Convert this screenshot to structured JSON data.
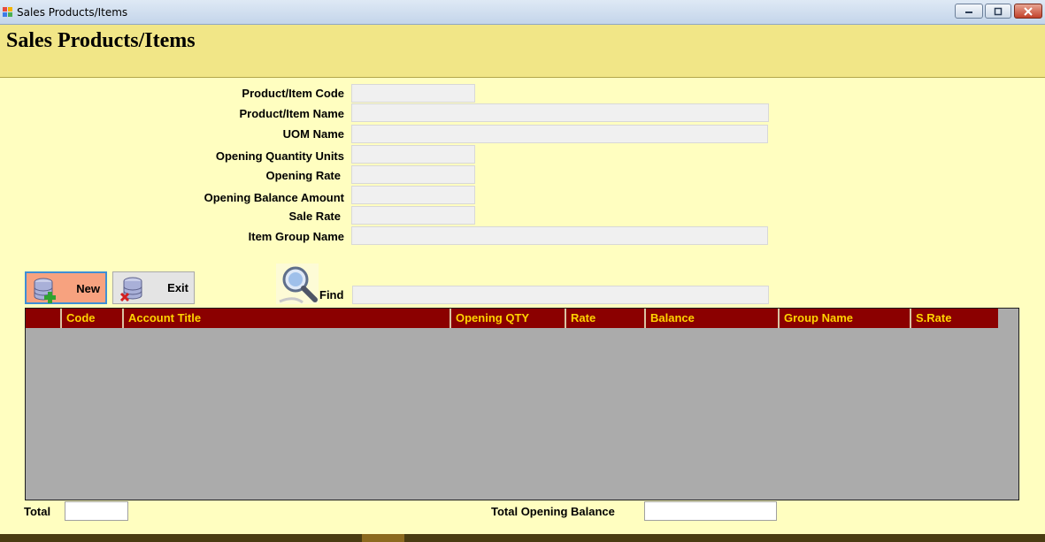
{
  "window": {
    "title": "Sales Products/Items",
    "controls": [
      "minimize-icon",
      "maximize-icon",
      "close-icon"
    ]
  },
  "page": {
    "title": "Sales Products/Items"
  },
  "form": {
    "product_item_code": {
      "label": "Product/Item Code",
      "value": ""
    },
    "product_item_name": {
      "label": "Product/Item Name",
      "value": ""
    },
    "uom_name": {
      "label": "UOM Name",
      "value": ""
    },
    "opening_quantity_units": {
      "label": "Opening Quantity Units",
      "value": ""
    },
    "opening_rate": {
      "label": "Opening Rate",
      "value": ""
    },
    "opening_balance_amount": {
      "label": "Opening Balance Amount",
      "value": ""
    },
    "sale_rate": {
      "label": "Sale Rate",
      "value": ""
    },
    "item_group_name": {
      "label": "Item Group Name",
      "value": ""
    }
  },
  "toolbar": {
    "new_label": "New",
    "exit_label": "Exit",
    "new_icon": "database-add-icon",
    "exit_icon": "database-delete-icon"
  },
  "find": {
    "label": "Find",
    "value": "",
    "icon": "magnifier-icon"
  },
  "grid": {
    "columns": [
      "",
      "Code",
      "Account Title",
      "Opening QTY",
      "Rate",
      "Balance",
      "Group Name",
      "S.Rate"
    ],
    "rows": []
  },
  "footer": {
    "total_label": "Total",
    "total_value": "",
    "total_opening_balance_label": "Total Opening Balance",
    "total_opening_balance_value": ""
  },
  "colors": {
    "background": "#fffec0",
    "header_band": "#f1e687",
    "grid_header": "#8b0000",
    "grid_header_text": "#ffd400",
    "grid_body": "#ababab",
    "new_button": "#f7a27f"
  }
}
